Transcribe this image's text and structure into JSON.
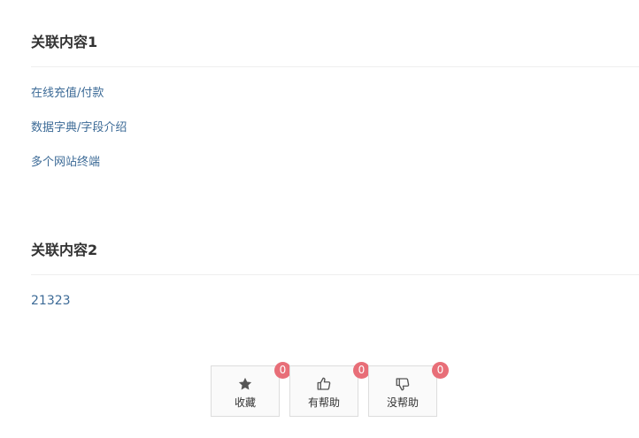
{
  "related1": {
    "title": "关联内容1",
    "links": [
      {
        "label": "在线充值/付款"
      },
      {
        "label": "数据字典/字段介绍"
      },
      {
        "label": "多个网站终端"
      }
    ]
  },
  "related2": {
    "title": "关联内容2",
    "links": [
      {
        "label": "21323"
      }
    ]
  },
  "actions": {
    "favorite": {
      "label": "收藏",
      "count": "0",
      "icon": "star-icon"
    },
    "helpful": {
      "label": "有帮助",
      "count": "0",
      "icon": "thumbs-up-icon"
    },
    "not_helpful": {
      "label": "没帮助",
      "count": "0",
      "icon": "thumbs-down-icon"
    }
  },
  "colors": {
    "link": "#3d6b97",
    "badge": "#e86e78",
    "title": "#333333"
  }
}
